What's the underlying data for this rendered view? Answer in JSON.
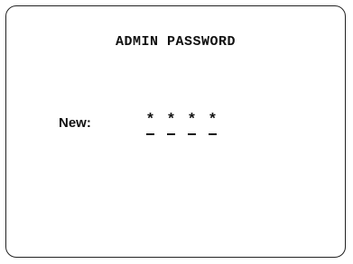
{
  "screen": {
    "title": "ADMIN PASSWORD"
  },
  "password_field": {
    "label": "New:",
    "chars": [
      "*",
      "*",
      "*",
      "*"
    ]
  }
}
